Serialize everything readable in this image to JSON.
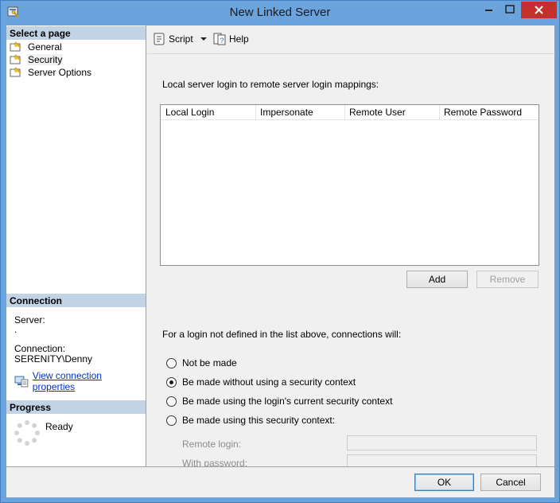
{
  "window": {
    "title": "New Linked Server"
  },
  "left_pane": {
    "select_page_header": "Select a page",
    "pages": [
      {
        "label": "General",
        "selected": false
      },
      {
        "label": "Security",
        "selected": true
      },
      {
        "label": "Server Options",
        "selected": false
      }
    ],
    "connection": {
      "header": "Connection",
      "server_label": "Server:",
      "server_value": ".",
      "connection_label": "Connection:",
      "connection_value": "SERENITY\\Denny",
      "view_properties_link": "View connection properties"
    },
    "progress": {
      "header": "Progress",
      "status": "Ready"
    }
  },
  "toolbar": {
    "script_label": "Script",
    "help_label": "Help"
  },
  "main": {
    "mappings_label": "Local server login to remote server login mappings:",
    "columns": [
      "Local Login",
      "Impersonate",
      "Remote User",
      "Remote Password"
    ],
    "add_button": "Add",
    "remove_button": "Remove",
    "undefined_login_label": "For a login not defined in the list above, connections will:",
    "options": [
      {
        "label": "Not be made",
        "checked": false
      },
      {
        "label": "Be made without using a security context",
        "checked": true
      },
      {
        "label": "Be made using the login's current security context",
        "checked": false
      },
      {
        "label": "Be made using this security context:",
        "checked": false
      }
    ],
    "remote_login_label": "Remote login:",
    "remote_login_value": "",
    "with_password_label": "With password:",
    "with_password_value": ""
  },
  "footer": {
    "ok_button": "OK",
    "cancel_button": "Cancel"
  },
  "colors": {
    "titlebar": "#6ba3dc",
    "close_button": "#c7302a",
    "section_header": "#c3d3e6",
    "link": "#0033cc"
  }
}
